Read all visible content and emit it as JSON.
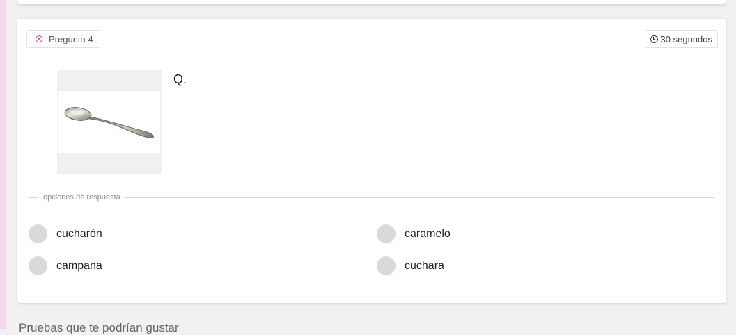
{
  "question": {
    "badge_label": "Pregunta 4",
    "timer_label": "30 segundos",
    "text": "Q.",
    "image_icon": "spoon-image"
  },
  "answers": {
    "section_label": "opciones de respuesta",
    "options": [
      {
        "label": "cucharón"
      },
      {
        "label": "caramelo"
      },
      {
        "label": "campana"
      },
      {
        "label": "cuchara"
      }
    ]
  },
  "footer": {
    "recommendations_title": "Pruebas que te podrían gustar"
  },
  "colors": {
    "accent": "#d9478a",
    "left_strip": "#f7d7ee",
    "radio": "#dadada"
  }
}
